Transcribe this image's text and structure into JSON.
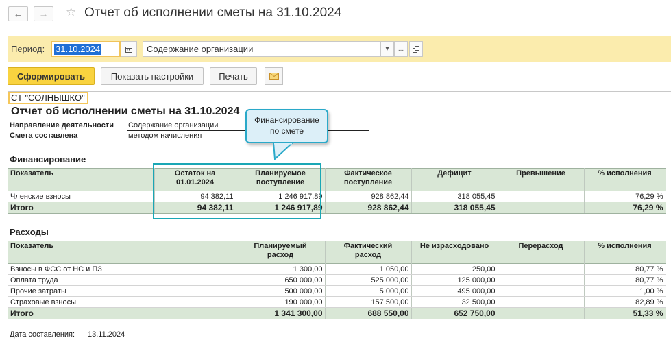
{
  "window": {
    "title": "Отчет об исполнении сметы на 31.10.2024"
  },
  "toolbar": {
    "period_label": "Период:",
    "period_value": "31.10.2024",
    "organization": "Содержание организации",
    "generate_label": "Сформировать",
    "settings_label": "Показать настройки",
    "print_label": "Печать"
  },
  "report": {
    "org_name": "СТ \"СОЛНЫШКО\"",
    "title": "Отчет об исполнении сметы на 31.10.2024",
    "meta": [
      {
        "label": "Направление деятельности",
        "value": "Содержание организации"
      },
      {
        "label": "Смета составлена",
        "value": "методом начисления"
      }
    ],
    "callout": {
      "line1": "Финансирование",
      "line2": "по смете"
    },
    "financing": {
      "section_title": "Финансирование",
      "headers": [
        "Показатель",
        "Остаток на\n01.01.2024",
        "Планируемое\nпоступление",
        "Фактическое\nпоступление",
        "Дефицит",
        "Превышение",
        "% исполнения"
      ],
      "rows": [
        [
          "Членские взносы",
          "94 382,11",
          "1 246 917,89",
          "928 862,44",
          "318 055,45",
          "",
          "76,29 %"
        ]
      ],
      "total": [
        "Итого",
        "94 382,11",
        "1 246 917,89",
        "928 862,44",
        "318 055,45",
        "",
        "76,29 %"
      ]
    },
    "expenses": {
      "section_title": "Расходы",
      "headers": [
        "Показатель",
        "Планируемый\nрасход",
        "Фактический\nрасход",
        "Не израсходовано",
        "Перерасход",
        "% исполнения"
      ],
      "rows": [
        [
          "Взносы в ФСС от НС и ПЗ",
          "1 300,00",
          "1 050,00",
          "250,00",
          "",
          "80,77 %"
        ],
        [
          "Оплата труда",
          "650 000,00",
          "525 000,00",
          "125 000,00",
          "",
          "80,77 %"
        ],
        [
          "Прочие затраты",
          "500 000,00",
          "5 000,00",
          "495 000,00",
          "",
          "1,00 %"
        ],
        [
          "Страховые взносы",
          "190 000,00",
          "157 500,00",
          "32 500,00",
          "",
          "82,89 %"
        ]
      ],
      "total": [
        "Итого",
        "1 341 300,00",
        "688 550,00",
        "652 750,00",
        "",
        "51,33 %"
      ]
    },
    "footer": {
      "label": "Дата составления:",
      "value": "13.11.2024"
    }
  },
  "colors": {
    "accent": "#f9d33f",
    "period_bar": "#fbecad",
    "table_header": "#d9e7d6",
    "highlight": "#1aa7b5"
  },
  "icons": [
    "back-arrow-icon",
    "forward-arrow-icon",
    "star-icon",
    "calendar-icon",
    "dropdown-icon",
    "ellipsis-icon",
    "open-icon",
    "envelope-icon"
  ]
}
